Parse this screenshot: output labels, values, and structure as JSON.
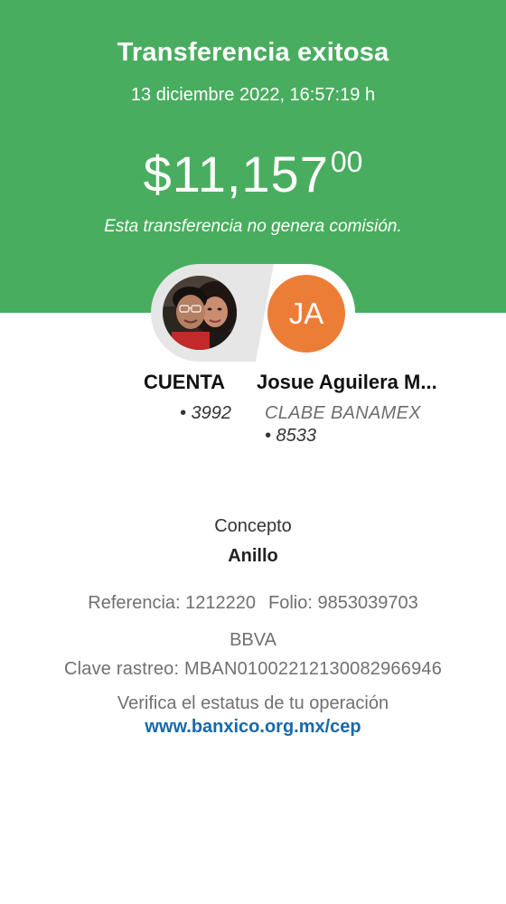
{
  "header": {
    "title": "Transferencia exitosa",
    "datetime": "13 diciembre 2022, 16:57:19 h",
    "amount_main": "$11,157",
    "amount_cents": "00",
    "fee_note": "Esta transferencia no genera comisión."
  },
  "source_account": {
    "name": "CUENTA",
    "number": "• 3992",
    "avatar": "profile-photo"
  },
  "destination_account": {
    "initials": "JA",
    "name": "Josue Aguilera M...",
    "bank": "CLABE BANAMEX",
    "number": "• 8533"
  },
  "details": {
    "concept_label": "Concepto",
    "concept_value": "Anillo",
    "reference": "Referencia: 1212220",
    "folio": "Folio: 9853039703",
    "bank": "BBVA",
    "tracking": "Clave rastreo: MBAN01002212130082966946",
    "verify_text": "Verifica el estatus de tu operación",
    "verify_link": "www.banxico.org.mx/cep"
  },
  "colors": {
    "header_bg": "#49ad5f",
    "avatar_initials_bg": "#ec7d37",
    "link": "#1769aa"
  }
}
